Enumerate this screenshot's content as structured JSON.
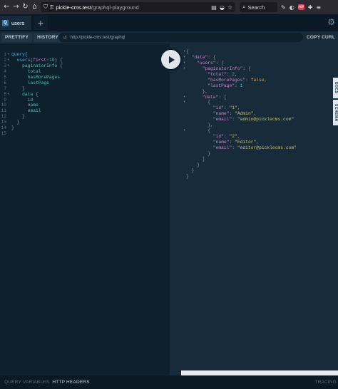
{
  "browser": {
    "url_host": "pickle-cms.test",
    "url_path": "/graphql-playground",
    "search_label": "Search",
    "ext_badge": "ABP"
  },
  "tabs": [
    {
      "badge": "Q",
      "label": "users"
    }
  ],
  "tab_add_label": "+",
  "toolbar": {
    "prettify": "PRETTIFY",
    "history": "HISTORY",
    "endpoint": "http://pickle-cms.test/graphql",
    "copy_curl": "COPY CURL"
  },
  "side_tabs": {
    "docs": "DOCS",
    "schema": "SCHEMA"
  },
  "editor_lines": [
    {
      "n": "1",
      "fold": true,
      "tokens": [
        [
          "kw",
          "query"
        ],
        [
          "pn",
          "{"
        ]
      ]
    },
    {
      "n": "2",
      "fold": true,
      "tokens": [
        [
          "pn",
          "  "
        ],
        [
          "fn",
          "users"
        ],
        [
          "pn",
          "("
        ],
        [
          "arg",
          "first"
        ],
        [
          "pn",
          ":"
        ],
        [
          "num",
          "10"
        ],
        [
          "pn",
          ") {"
        ]
      ]
    },
    {
      "n": "3",
      "fold": true,
      "tokens": [
        [
          "pn",
          "    "
        ],
        [
          "fld",
          "paginatorInfo"
        ],
        [
          "pn",
          " {"
        ]
      ]
    },
    {
      "n": "4",
      "fold": false,
      "tokens": [
        [
          "pn",
          "      "
        ],
        [
          "fld",
          "total"
        ]
      ]
    },
    {
      "n": "5",
      "fold": false,
      "tokens": [
        [
          "pn",
          "      "
        ],
        [
          "fld",
          "hasMorePages"
        ]
      ]
    },
    {
      "n": "6",
      "fold": false,
      "tokens": [
        [
          "pn",
          "      "
        ],
        [
          "fld",
          "lastPage"
        ]
      ]
    },
    {
      "n": "7",
      "fold": false,
      "tokens": [
        [
          "pn",
          "    }"
        ]
      ]
    },
    {
      "n": "8",
      "fold": true,
      "tokens": [
        [
          "pn",
          "    "
        ],
        [
          "fld",
          "data"
        ],
        [
          "pn",
          " {"
        ]
      ]
    },
    {
      "n": "9",
      "fold": false,
      "tokens": [
        [
          "pn",
          "      "
        ],
        [
          "fld",
          "id"
        ]
      ]
    },
    {
      "n": "10",
      "fold": false,
      "tokens": [
        [
          "pn",
          "      "
        ],
        [
          "fld",
          "name"
        ]
      ]
    },
    {
      "n": "11",
      "fold": false,
      "tokens": [
        [
          "pn",
          "      "
        ],
        [
          "fld",
          "email"
        ]
      ]
    },
    {
      "n": "12",
      "fold": false,
      "tokens": [
        [
          "pn",
          "    }"
        ]
      ]
    },
    {
      "n": "13",
      "fold": false,
      "tokens": [
        [
          "pn",
          "  }"
        ]
      ]
    },
    {
      "n": "14",
      "fold": false,
      "tokens": [
        [
          "pn",
          "}"
        ]
      ]
    },
    {
      "n": "15",
      "fold": false,
      "tokens": []
    }
  ],
  "result_lines": [
    {
      "fold": true,
      "tokens": [
        [
          "rp",
          "{"
        ]
      ]
    },
    {
      "fold": true,
      "tokens": [
        [
          "rp",
          "  "
        ],
        [
          "key",
          "\"data\""
        ],
        [
          "rp",
          ": {"
        ]
      ]
    },
    {
      "fold": true,
      "tokens": [
        [
          "rp",
          "    "
        ],
        [
          "key",
          "\"users\""
        ],
        [
          "rp",
          ": {"
        ]
      ]
    },
    {
      "fold": true,
      "tokens": [
        [
          "rp",
          "      "
        ],
        [
          "key",
          "\"paginatorInfo\""
        ],
        [
          "rp",
          ": {"
        ]
      ]
    },
    {
      "fold": false,
      "tokens": [
        [
          "rp",
          "        "
        ],
        [
          "key",
          "\"total\""
        ],
        [
          "rp",
          ": "
        ],
        [
          "rnum",
          "2"
        ],
        [
          "rp",
          ","
        ]
      ]
    },
    {
      "fold": false,
      "tokens": [
        [
          "rp",
          "        "
        ],
        [
          "key",
          "\"hasMorePages\""
        ],
        [
          "rp",
          ": "
        ],
        [
          "bool",
          "false"
        ],
        [
          "rp",
          ","
        ]
      ]
    },
    {
      "fold": false,
      "tokens": [
        [
          "rp",
          "        "
        ],
        [
          "key",
          "\"lastPage\""
        ],
        [
          "rp",
          ": "
        ],
        [
          "rnum",
          "1"
        ]
      ]
    },
    {
      "fold": false,
      "tokens": [
        [
          "rp",
          "      },"
        ]
      ]
    },
    {
      "fold": true,
      "tokens": [
        [
          "rp",
          "      "
        ],
        [
          "key",
          "\"data\""
        ],
        [
          "rp",
          ": ["
        ]
      ]
    },
    {
      "fold": true,
      "tokens": [
        [
          "rp",
          "        {"
        ]
      ]
    },
    {
      "fold": false,
      "tokens": [
        [
          "rp",
          "          "
        ],
        [
          "key",
          "\"id\""
        ],
        [
          "rp",
          ": "
        ],
        [
          "str",
          "\"1\""
        ],
        [
          "rp",
          ","
        ]
      ]
    },
    {
      "fold": false,
      "tokens": [
        [
          "rp",
          "          "
        ],
        [
          "key",
          "\"name\""
        ],
        [
          "rp",
          ": "
        ],
        [
          "str",
          "\"Admin\""
        ],
        [
          "rp",
          ","
        ]
      ]
    },
    {
      "fold": false,
      "tokens": [
        [
          "rp",
          "          "
        ],
        [
          "key",
          "\"email\""
        ],
        [
          "rp",
          ": "
        ],
        [
          "str",
          "\"admin@picklecms.com\""
        ]
      ]
    },
    {
      "fold": false,
      "tokens": [
        [
          "rp",
          "        },"
        ]
      ]
    },
    {
      "fold": true,
      "tokens": [
        [
          "rp",
          "        {"
        ]
      ]
    },
    {
      "fold": false,
      "tokens": [
        [
          "rp",
          "          "
        ],
        [
          "key",
          "\"id\""
        ],
        [
          "rp",
          ": "
        ],
        [
          "str",
          "\"2\""
        ],
        [
          "rp",
          ","
        ]
      ]
    },
    {
      "fold": false,
      "tokens": [
        [
          "rp",
          "          "
        ],
        [
          "key",
          "\"name\""
        ],
        [
          "rp",
          ": "
        ],
        [
          "str",
          "\"Editor\""
        ],
        [
          "rp",
          ","
        ]
      ]
    },
    {
      "fold": false,
      "tokens": [
        [
          "rp",
          "          "
        ],
        [
          "key",
          "\"email\""
        ],
        [
          "rp",
          ": "
        ],
        [
          "str",
          "\"editor@picklecms.com\""
        ]
      ]
    },
    {
      "fold": false,
      "tokens": [
        [
          "rp",
          "        }"
        ]
      ]
    },
    {
      "fold": false,
      "tokens": [
        [
          "rp",
          "      ]"
        ]
      ]
    },
    {
      "fold": false,
      "tokens": [
        [
          "rp",
          "    }"
        ]
      ]
    },
    {
      "fold": false,
      "tokens": [
        [
          "rp",
          "  }"
        ]
      ]
    },
    {
      "fold": false,
      "tokens": [
        [
          "rp",
          "}"
        ]
      ]
    }
  ],
  "bottom_bar": {
    "query_variables": "QUERY VARIABLES",
    "http_headers": "HTTP HEADERS",
    "tracing": "TRACING"
  },
  "icons": {
    "back": "back-arrow-icon",
    "forward": "forward-arrow-icon",
    "reload": "reload-icon",
    "home": "home-icon",
    "shield": "shield-icon",
    "lock": "lock-icon",
    "run": "play-icon",
    "settings": "gear-icon",
    "history": "history-icon"
  },
  "colors": {
    "editor_bg": "#0f202d",
    "result_bg": "#172b3a",
    "keyword": "#4ab0d6",
    "field": "#3fc5b6",
    "json_key": "#d57bd1",
    "json_string": "#c9c16a",
    "json_number": "#2cc3c1",
    "json_bool": "#e5a14e"
  }
}
